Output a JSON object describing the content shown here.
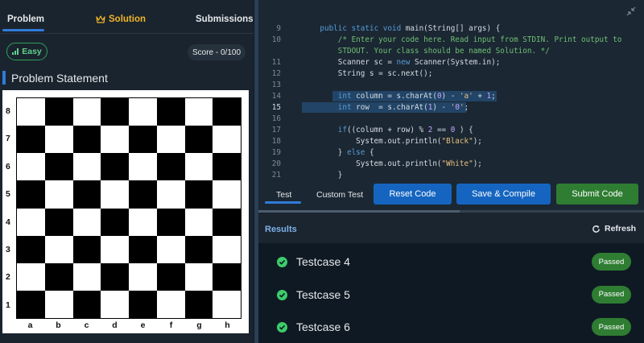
{
  "left_panel": {
    "tabs": [
      {
        "label": "Problem"
      },
      {
        "label": "Solution"
      },
      {
        "label": "Submissions"
      }
    ],
    "difficulty": "Easy",
    "score": "Score - 0/100",
    "section_title": "Problem Statement",
    "board": {
      "ranks": [
        "8",
        "7",
        "6",
        "5",
        "4",
        "3",
        "2",
        "1"
      ],
      "files": [
        "a",
        "b",
        "c",
        "d",
        "e",
        "f",
        "g",
        "h"
      ]
    }
  },
  "editor": {
    "lines": [
      {
        "n": "9",
        "code": "    public static void main(String[] args) {"
      },
      {
        "n": "10",
        "code": "        /* Enter your code here. Read input from STDIN. Print output to"
      },
      {
        "n": "",
        "code": "        STDOUT. Your class should be named Solution. */"
      },
      {
        "n": "11",
        "code": "        Scanner sc = new Scanner(System.in);"
      },
      {
        "n": "12",
        "code": "        String s = sc.next();"
      },
      {
        "n": "13",
        "code": ""
      },
      {
        "n": "14",
        "code": "        int column = s.charAt(0) - 'a' + 1;"
      },
      {
        "n": "15",
        "code": "        int row  = s.charAt(1) - '0';"
      },
      {
        "n": "16",
        "code": ""
      },
      {
        "n": "17",
        "code": "        if((column + row) % 2 == 0 ) {"
      },
      {
        "n": "18",
        "code": "            System.out.println(\"Black\");"
      },
      {
        "n": "19",
        "code": "        } else {"
      },
      {
        "n": "20",
        "code": "            System.out.println(\"White\");"
      },
      {
        "n": "21",
        "code": "        }"
      }
    ]
  },
  "actions": {
    "tab_test": "Test",
    "tab_custom": "Custom Test",
    "reset": "Reset Code",
    "compile": "Save & Compile",
    "submit": "Submit Code"
  },
  "results": {
    "title": "Results",
    "refresh": "Refresh",
    "testcases": [
      {
        "name": "Testcase 4",
        "status": "Passed"
      },
      {
        "name": "Testcase 5",
        "status": "Passed"
      },
      {
        "name": "Testcase 6",
        "status": "Passed"
      }
    ]
  },
  "colors": {
    "accent": "#2f7cd9",
    "solution": "#f0b429",
    "passed": "#2e7d32",
    "check": "#3dcc6b"
  }
}
